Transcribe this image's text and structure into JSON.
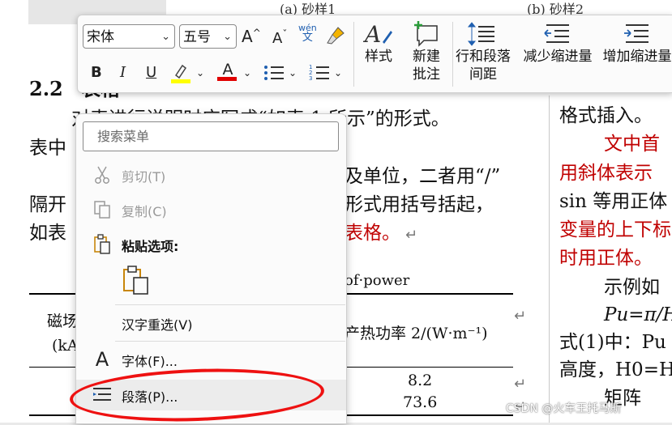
{
  "doc": {
    "top_captions": [
      "(a) 砂样1",
      "(b) 砂样2"
    ],
    "heading_num": "2.2",
    "heading_text": "表格",
    "left_lines": [
      "对表进行说明时应写成“如表 1 所示”的形式。",
      "表中",
      "及单位，二者用“/”",
      "隔开",
      "形式用括号括起，",
      "如表",
      "表格。"
    ],
    "table_title_en": "of·power",
    "table_header_left": "磁场",
    "table_header_left2": "(kA",
    "table_header_right": "产热功率 2/(W·m⁻¹)",
    "table_values": [
      "8.2",
      "73.6"
    ],
    "right_lines": [
      "格式插入。",
      "文中首",
      "用斜体表示",
      "sin 等用正体",
      "变量的上下标",
      "时用正体。",
      "示例如",
      "Pu=π/H",
      "式(1)中：Pu",
      "高度，H0=H",
      "矩阵"
    ],
    "return_mark": "↵",
    "watermark": "CSDN @火车王托马斯"
  },
  "ribbon": {
    "font_name": "宋体",
    "font_size": "五号",
    "grow_font": "A^",
    "shrink_font": "Aˇ",
    "phonetic_top": "wén",
    "phonetic_bottom": "文",
    "bold": "B",
    "italic": "I",
    "underline": "U",
    "font_color_letter": "A",
    "highlight_color": "#ffff00",
    "font_color": "#e00000",
    "styles_label": "样式",
    "new_comment_label": "新建\n批注",
    "new_comment_l1": "新建",
    "new_comment_l2": "批注",
    "line_spacing_l1": "行和段落",
    "line_spacing_l2": "间距",
    "decrease_indent": "减少缩进量",
    "increase_indent": "增加缩进量"
  },
  "menu": {
    "search_placeholder": "搜索菜单",
    "cut": "剪切(T)",
    "copy": "复制(C)",
    "paste_options": "粘贴选项:",
    "reconvert": "汉字重选(V)",
    "font": "字体(F)...",
    "paragraph": "段落(P)..."
  }
}
